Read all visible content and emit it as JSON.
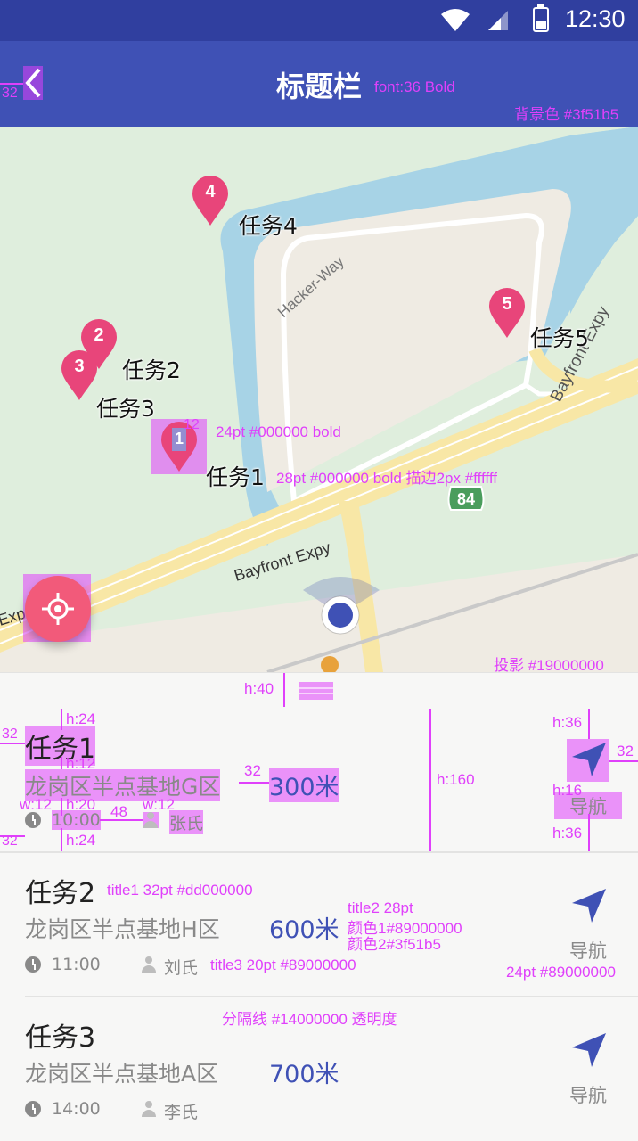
{
  "status_bar": {
    "time": "12:30"
  },
  "app_bar": {
    "title": "标题栏",
    "bg_color": "#3f51b5",
    "annotations": {
      "title_font": "font:36  Bold",
      "bg": "背景色 #3f51b5",
      "back_margin": "32"
    }
  },
  "map": {
    "road_labels": {
      "hacker_way": "Hacker-Way",
      "bayfront_1": "Bayfront Expy",
      "bayfront_2": "Bayfront Expy",
      "bayfront_3": "Exp",
      "shield": "84"
    },
    "markers": [
      {
        "num": "1",
        "label": "任务1"
      },
      {
        "num": "2",
        "label": "任务2"
      },
      {
        "num": "3",
        "label": "任务3"
      },
      {
        "num": "4",
        "label": "任务4"
      },
      {
        "num": "5",
        "label": "任务5"
      }
    ],
    "annotations": {
      "pin_num_size": "12",
      "pin_spec": "24pt  #000000  bold",
      "label_spec": "28pt  #000000  bold  描边2px  #ffffff",
      "shadow_spec": "投影  #19000000"
    }
  },
  "sheet": {
    "annotations": {
      "handle_h": "h:40",
      "item_h": "h:160",
      "h24a": "h:24",
      "h24b": "h:24",
      "h12": "h:12",
      "h20": "h:20",
      "h36a": "h:36",
      "h16": "h:16",
      "h36b": "h:36",
      "w12a": "w:12",
      "w12b": "w:12",
      "gap32a": "32",
      "gap32b": "32",
      "gap32c": "32",
      "gap32d": "32",
      "gap48": "48",
      "title1": "title1  32pt  #dd000000",
      "title2_a": "title2  28pt",
      "title2_b": "颜色1#89000000",
      "title2_c": "颜色2#3f51b5",
      "title3": "title3  20pt  #89000000",
      "nav_spec": "24pt  #89000000",
      "divider": "分隔线 #14000000  透明度"
    },
    "items": [
      {
        "title": "任务1",
        "address": "龙岗区半点基地G区",
        "distance": "300米",
        "time": "10:00",
        "person": "张氏",
        "nav": "导航"
      },
      {
        "title": "任务2",
        "address": "龙岗区半点基地H区",
        "distance": "600米",
        "time": "11:00",
        "person": "刘氏",
        "nav": "导航"
      },
      {
        "title": "任务3",
        "address": "龙岗区半点基地A区",
        "distance": "700米",
        "time": "14:00",
        "person": "李氏",
        "nav": "导航"
      }
    ]
  }
}
